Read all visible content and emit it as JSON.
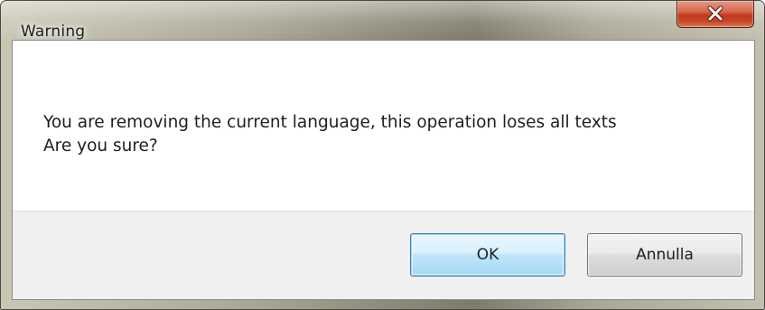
{
  "window": {
    "title": "Warning",
    "close_icon": "close-x-icon"
  },
  "message": {
    "line1": "You are removing the current language, this operation loses all texts",
    "line2": "Are you sure?"
  },
  "buttons": {
    "ok_label": "OK",
    "cancel_label": "Annulla"
  },
  "colors": {
    "close_button": "#c7432a",
    "default_button_border": "#3c7fb1",
    "button_bar": "#f0f0f0"
  }
}
